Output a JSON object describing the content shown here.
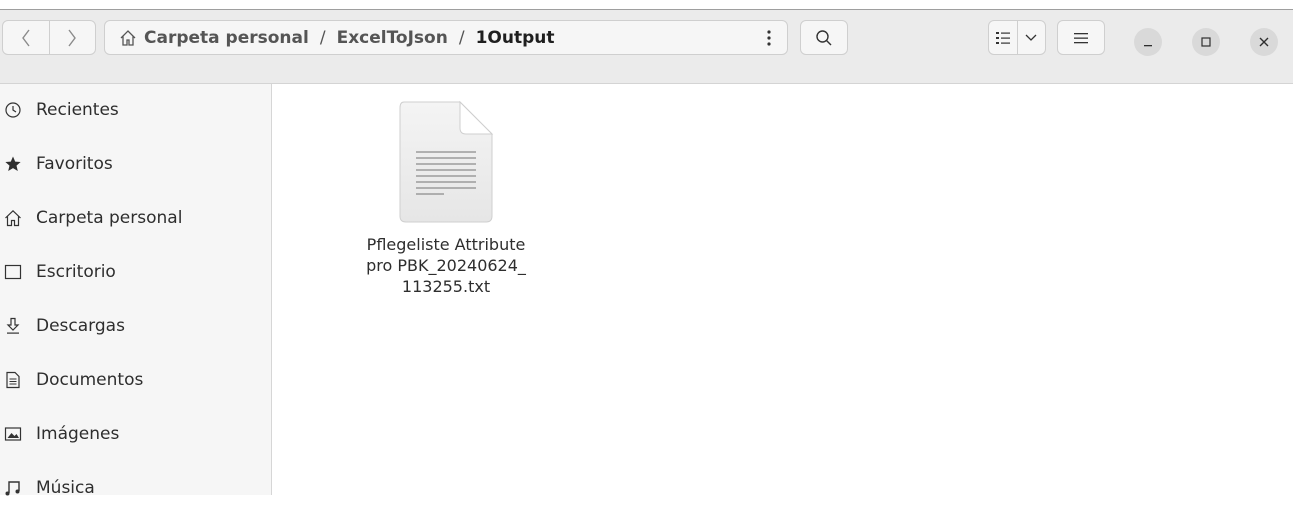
{
  "path": {
    "segments": [
      "Carpeta personal",
      "ExcelToJson"
    ],
    "current": "1Output",
    "separator": "/"
  },
  "sidebar": {
    "items": [
      {
        "label": "Recientes",
        "icon": "clock-icon"
      },
      {
        "label": "Favoritos",
        "icon": "star-icon"
      },
      {
        "label": "Carpeta personal",
        "icon": "home-icon"
      },
      {
        "label": "Escritorio",
        "icon": "desktop-icon"
      },
      {
        "label": "Descargas",
        "icon": "download-icon"
      },
      {
        "label": "Documentos",
        "icon": "document-icon"
      },
      {
        "label": "Imágenes",
        "icon": "image-icon"
      },
      {
        "label": "Música",
        "icon": "music-icon"
      }
    ]
  },
  "files": [
    {
      "line1": "Pflegeliste Attribute",
      "line2": "pro PBK_20240624_",
      "line3": "113255.txt",
      "icon": "text-file-icon"
    }
  ],
  "colors": {
    "header_bg": "#ebebeb",
    "sidebar_bg": "#f6f6f6",
    "window_button_bg": "#d9d9d9"
  }
}
